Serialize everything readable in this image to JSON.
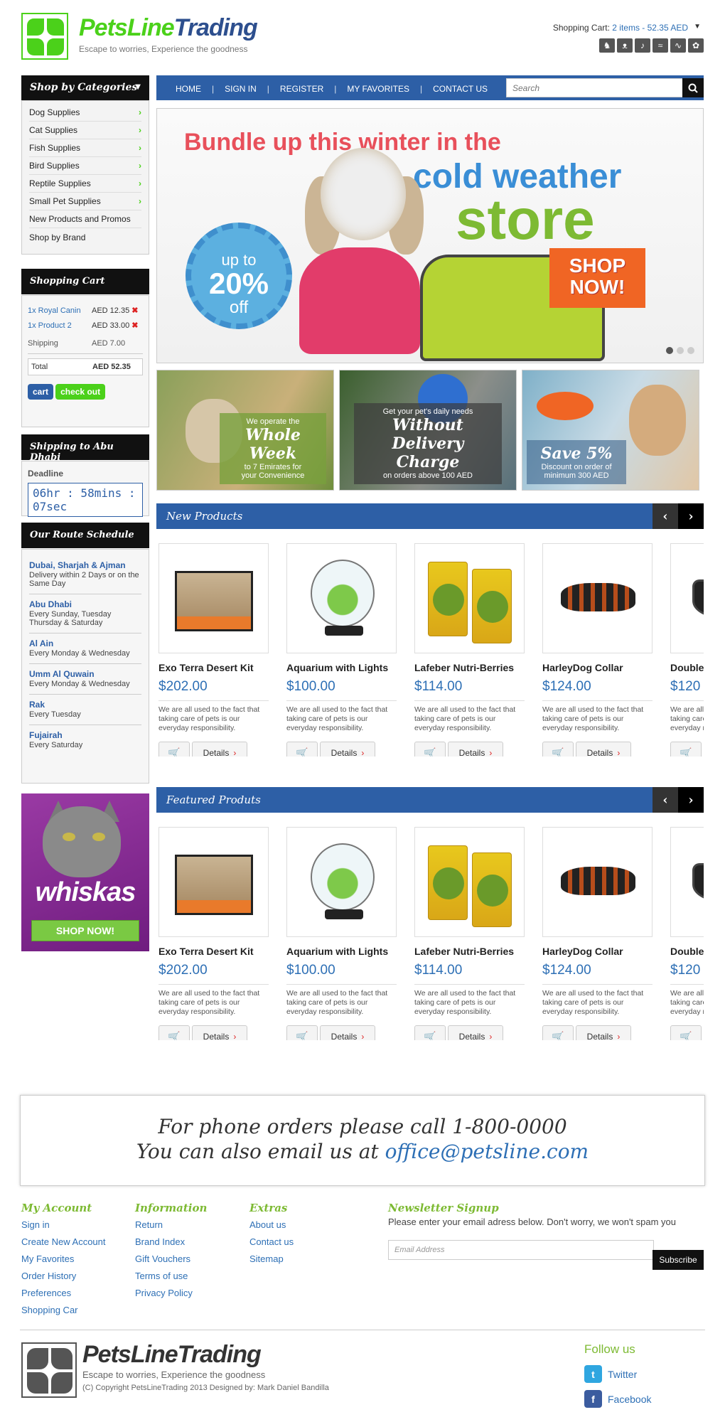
{
  "brand": {
    "name_part1": "PetsLine",
    "name_part2": "Trading",
    "tagline": "Escape to worries, Experience the goodness"
  },
  "header": {
    "cart_label": "Shopping Cart:",
    "cart_summary": "2 items - 52.35 AED",
    "pet_icons": [
      "dog-icon",
      "cat-icon",
      "bird-icon",
      "fish-icon",
      "reptile-icon",
      "rabbit-icon"
    ]
  },
  "categories": {
    "title": "Shop by Categories",
    "items": [
      "Dog Supplies",
      "Cat Supplies",
      "Fish Supplies",
      "Bird Supplies",
      "Reptile Supplies",
      "Small Pet Supplies",
      "New Products and Promos",
      "Shop by Brand"
    ]
  },
  "nav": {
    "items": [
      "HOME",
      "SIGN IN",
      "REGISTER",
      "MY FAVORITES",
      "CONTACT US"
    ],
    "search_placeholder": "Search"
  },
  "cart": {
    "title": "Shopping Cart",
    "lines": [
      {
        "item": "1x Royal Canin",
        "price": "AED 12.35"
      },
      {
        "item": "1x Product 2",
        "price": "AED 33.00"
      }
    ],
    "shipping_label": "Shipping",
    "shipping_value": "AED 7.00",
    "total_label": "Total",
    "total_value": "AED 52.35",
    "cart_btn": "cart",
    "checkout_btn": "check out"
  },
  "shipping": {
    "title": "Shipping to Abu Dhabi",
    "deadline_label": "Deadline",
    "timer": "06hr : 58mins : 07sec"
  },
  "route": {
    "title": "Our Route Schedule",
    "items": [
      {
        "place": "Dubai, Sharjah & Ajman",
        "text": " Delivery within 2 Days or on the Same Day"
      },
      {
        "place": "Abu Dhabi",
        "text": "Every Sunday, Tuesday Thursday & Saturday"
      },
      {
        "place": "Al Ain",
        "text": "Every Monday & Wednesday"
      },
      {
        "place": "Umm Al Quwain",
        "text": "Every Monday & Wednesday"
      },
      {
        "place": "Rak",
        "text": "Every Tuesday"
      },
      {
        "place": "Fujairah",
        "text": "Every Saturday"
      }
    ]
  },
  "ad": {
    "word": "whiskas",
    "button": "SHOP NOW!"
  },
  "hero": {
    "line1": "Bundle up this winter in the",
    "line2": "cold weather",
    "line3": "store",
    "badge_top": "up to",
    "badge_mid": "20%",
    "badge_bot": "off",
    "cta_line1": "SHOP",
    "cta_line2": "NOW!"
  },
  "promos": [
    {
      "small": "We operate the",
      "big": "Whole Week",
      "rest1": "to 7 Emirates for",
      "rest2": "your Convenience"
    },
    {
      "small": "Get your pet's daily needs",
      "big": "Without Delivery Charge",
      "rest1": "on orders above 100 AED",
      "rest2": ""
    },
    {
      "small": "",
      "big": "Save 5%",
      "rest1": "Discount on order of",
      "rest2": "minimum 300 AED"
    }
  ],
  "new_products": {
    "title": "New Products"
  },
  "featured_products": {
    "title": "Featured Produts"
  },
  "products": [
    {
      "name": "Exo Terra Desert Kit",
      "price": "$202.00"
    },
    {
      "name": "Aquarium with Lights",
      "price": "$100.00"
    },
    {
      "name": "Lafeber Nutri-Berries",
      "price": "$114.00"
    },
    {
      "name": "HarleyDog Collar",
      "price": "$124.00"
    },
    {
      "name": "Double",
      "price": "$120"
    }
  ],
  "product_desc": "We are all used to the fact that taking care of pets is our everyday responsibility.",
  "product_details_label": "Details",
  "callbox": {
    "line1": "For phone orders please call 1-800-0000",
    "line2_prefix": "You can also email us at ",
    "email": "office@petsline.com"
  },
  "footer": {
    "account": {
      "title": "My Account",
      "links": [
        "Sign in",
        "Create New Account",
        "My Favorites",
        "Order History",
        "Preferences",
        "Shopping Car"
      ]
    },
    "information": {
      "title": "Information",
      "links": [
        "Return",
        "Brand Index",
        "Gift Vouchers",
        "Terms of use",
        "Privacy Policy"
      ]
    },
    "extras": {
      "title": "Extras",
      "links": [
        "About us",
        "Contact us",
        "Sitemap"
      ]
    },
    "newsletter": {
      "title": "Newsletter Signup",
      "text": "Please enter your email adress below. Don't worry, we won't spam you",
      "placeholder": "Email Address",
      "button": "Subscribe"
    },
    "copyright": "(C) Copyright PetsLineTrading 2013 Designed by: Mark Daniel Bandilla",
    "follow_title": "Follow us",
    "twitter": "Twitter",
    "facebook": "Facebook"
  },
  "colors": {
    "green": "#4bd11a",
    "blue": "#2d5fa6",
    "link": "#2d6fb5",
    "red": "#d22222"
  }
}
